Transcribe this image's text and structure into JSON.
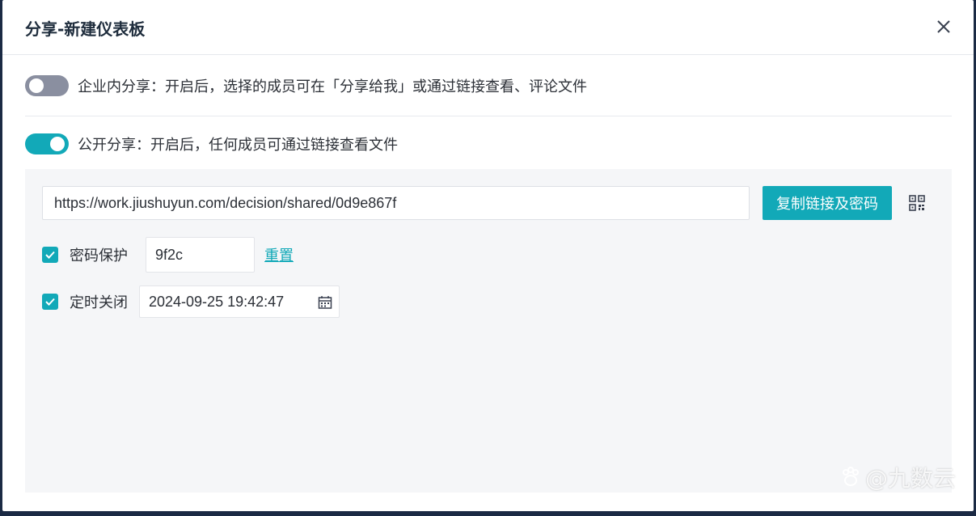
{
  "dialog": {
    "title": "分享-新建仪表板"
  },
  "internal_share": {
    "enabled": false,
    "label": "企业内分享：开启后，选择的成员可在「分享给我」或通过链接查看、评论文件"
  },
  "public_share": {
    "enabled": true,
    "label": "公开分享：开启后，任何成员可通过链接查看文件",
    "url": "https://work.jiushuyun.com/decision/shared/0d9e867f",
    "copy_button": "复制链接及密码",
    "password": {
      "checked": true,
      "label": "密码保护",
      "value": "9f2c",
      "reset": "重置"
    },
    "expiry": {
      "checked": true,
      "label": "定时关闭",
      "value": "2024-09-25 19:42:47"
    }
  },
  "watermark": "@九数云",
  "colors": {
    "accent": "#12a9b8",
    "toggle_off": "#8a8fa0",
    "panel_bg": "#f5f6f8"
  },
  "icons": [
    "close-icon",
    "qr-code-icon",
    "check-icon",
    "calendar-icon",
    "paw-icon"
  ]
}
